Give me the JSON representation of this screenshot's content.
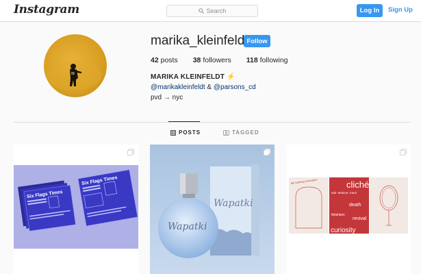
{
  "header": {
    "logo": "Instagram",
    "search_placeholder": "Search",
    "login_label": "Log In",
    "signup_label": "Sign Up"
  },
  "profile": {
    "username": "marika_kleinfeldt",
    "follow_label": "Follow",
    "posts_count": "42",
    "posts_label": "posts",
    "followers_count": "38",
    "followers_label": "followers",
    "following_count": "118",
    "following_label": "following",
    "bio_name": "MARIKA KLEINFELDT ⚡",
    "bio_mention_1": "@marikakleinfeldt",
    "bio_and": " & ",
    "bio_mention_2": "@parsons_cd",
    "bio_location": "pvd → nyc"
  },
  "tabs": [
    {
      "label": "POSTS",
      "icon": "grid-icon",
      "active": true
    },
    {
      "label": "TAGGED",
      "icon": "tag-icon",
      "active": false
    }
  ],
  "posts": [
    {
      "caption_1": "Six Flags Times",
      "caption_2": "Six Flags Times",
      "icon": "multi-post-icon"
    },
    {
      "caption_1": "Wapatki",
      "caption_2": "Wapatki",
      "icon": "multi-post-icon"
    },
    {
      "caption_1": "cliché",
      "caption_2": "death",
      "caption_3": "revival",
      "caption_4": "curiosity",
      "caption_5": "fetishism",
      "caption_6": "esk-\ntension-\nment",
      "caption_7": "the framing of fandom",
      "icon": "multi-post-icon"
    }
  ],
  "colors": {
    "accent": "#3897f0",
    "link": "#003569",
    "border": "#dbdbdb",
    "background": "#fafafa"
  }
}
